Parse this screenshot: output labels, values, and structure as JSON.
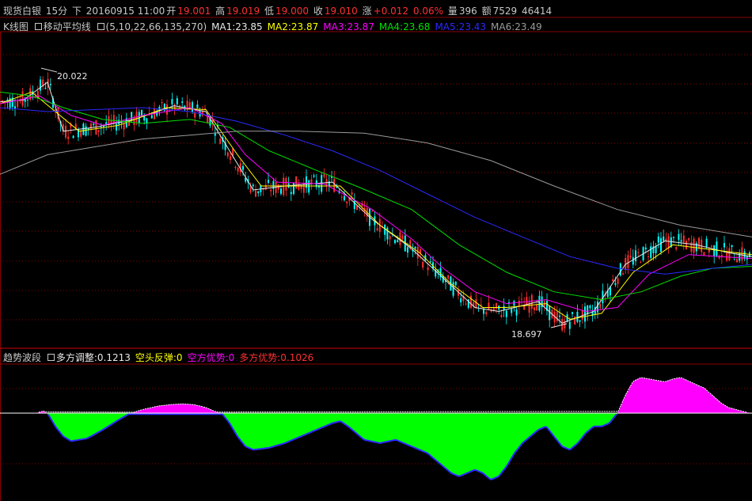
{
  "header": {
    "symbol": "现货白银",
    "period": "15分",
    "dir": "下",
    "datetime": "20160915 11:00",
    "open_label": "开",
    "open": "19.001",
    "high_label": "高",
    "high": "19.019",
    "low_label": "低",
    "low": "19.000",
    "close_label": "收",
    "close": "19.010",
    "change_label": "涨",
    "change": "+0.012",
    "change_pct": "0.06%",
    "volume_label": "量",
    "volume": "396",
    "amount_label": "额",
    "amount": "7529",
    "extra": "46414"
  },
  "ma_bar": {
    "chart_name": "K线图",
    "indicator": "移动平均线",
    "params": "(5,10,22,66,135,270)",
    "items": [
      {
        "label": "MA1:23.85",
        "color": "#e8e8e8"
      },
      {
        "label": "MA2:23.87",
        "color": "#ffff00"
      },
      {
        "label": "MA3:23.87",
        "color": "#ff00ff"
      },
      {
        "label": "MA4:23.68",
        "color": "#00e000"
      },
      {
        "label": "MA5:23.43",
        "color": "#2a2aff"
      },
      {
        "label": "MA6:23.49",
        "color": "#9a9a9a"
      }
    ]
  },
  "indicator_bar": {
    "name": "趋势波段",
    "items": [
      {
        "label": "多方调整:0.1213",
        "color": "#e8e8e8"
      },
      {
        "label": "空头反弹:0",
        "color": "#ffff00"
      },
      {
        "label": "空方优势:0",
        "color": "#ff00ff"
      },
      {
        "label": "多方优势:0.1026",
        "color": "#ff3030"
      }
    ]
  },
  "colors": {
    "grid": "#8b0000",
    "up": "#ff3030",
    "down": "#00ffff",
    "bull": "#ff00ff",
    "bear": "#00ff00",
    "bear_edge": "#2a2aff"
  },
  "chart_data": [
    {
      "type": "line",
      "title": "现货白银 15分",
      "annotations": [
        {
          "label": "20.022",
          "x": 52,
          "y": 20.022
        },
        {
          "label": "18.697",
          "x": 696,
          "y": 18.697
        }
      ],
      "ylim": [
        18.6,
        20.2
      ],
      "xlim": [
        0,
        950
      ],
      "series": [
        {
          "name": "MA1",
          "color": "#e8e8e8",
          "x": [
            0,
            30,
            60,
            80,
            120,
            170,
            220,
            260,
            290,
            320,
            360,
            420,
            470,
            520,
            560,
            600,
            630,
            680,
            710,
            750,
            790,
            840,
            880,
            920,
            950
          ],
          "values": [
            19.85,
            19.86,
            19.95,
            19.7,
            19.72,
            19.76,
            19.83,
            19.8,
            19.6,
            19.4,
            19.42,
            19.44,
            19.25,
            19.1,
            18.95,
            18.8,
            18.78,
            18.83,
            18.72,
            18.78,
            19.02,
            19.14,
            19.12,
            19.08,
            19.06
          ]
        },
        {
          "name": "MA2",
          "color": "#ffff00",
          "x": [
            0,
            40,
            70,
            100,
            150,
            210,
            260,
            300,
            330,
            370,
            430,
            480,
            530,
            570,
            610,
            640,
            690,
            720,
            760,
            800,
            850,
            890,
            950
          ],
          "values": [
            19.84,
            19.9,
            19.8,
            19.7,
            19.73,
            19.82,
            19.81,
            19.58,
            19.42,
            19.42,
            19.42,
            19.22,
            19.08,
            18.92,
            18.8,
            18.8,
            18.82,
            18.74,
            18.77,
            18.98,
            19.12,
            19.1,
            19.07
          ]
        },
        {
          "name": "MA3",
          "color": "#ff00ff",
          "x": [
            0,
            50,
            90,
            130,
            180,
            240,
            280,
            310,
            350,
            410,
            470,
            520,
            560,
            600,
            640,
            690,
            740,
            780,
            820,
            870,
            910,
            950
          ],
          "values": [
            19.84,
            19.88,
            19.78,
            19.73,
            19.78,
            19.82,
            19.74,
            19.58,
            19.44,
            19.43,
            19.3,
            19.15,
            19.0,
            18.88,
            18.82,
            18.84,
            18.78,
            18.8,
            18.97,
            19.07,
            19.06,
            19.05
          ]
        },
        {
          "name": "MA4",
          "color": "#00e000",
          "x": [
            0,
            40,
            80,
            130,
            180,
            240,
            290,
            340,
            400,
            450,
            520,
            580,
            640,
            700,
            760,
            810,
            860,
            900,
            950
          ],
          "values": [
            19.9,
            19.88,
            19.82,
            19.76,
            19.74,
            19.76,
            19.72,
            19.6,
            19.5,
            19.42,
            19.3,
            19.12,
            18.98,
            18.88,
            18.84,
            18.88,
            18.96,
            19.0,
            19.01
          ]
        },
        {
          "name": "MA5",
          "color": "#2a2aff",
          "x": [
            0,
            60,
            120,
            180,
            240,
            300,
            360,
            420,
            480,
            540,
            600,
            660,
            720,
            780,
            840,
            900,
            950
          ],
          "values": [
            19.82,
            19.8,
            19.81,
            19.82,
            19.8,
            19.75,
            19.68,
            19.6,
            19.5,
            19.38,
            19.26,
            19.16,
            19.06,
            19.0,
            18.97,
            19.0,
            19.02
          ]
        },
        {
          "name": "MA6",
          "color": "#9a9a9a",
          "x": [
            0,
            60,
            120,
            180,
            240,
            300,
            380,
            460,
            540,
            620,
            700,
            780,
            860,
            950
          ],
          "values": [
            19.48,
            19.58,
            19.62,
            19.66,
            19.68,
            19.7,
            19.7,
            19.69,
            19.64,
            19.55,
            19.42,
            19.3,
            19.22,
            19.16
          ]
        }
      ]
    },
    {
      "type": "area",
      "title": "趋势波段",
      "ylim": [
        -0.12,
        0.06
      ],
      "x": [
        0,
        45,
        55,
        60,
        70,
        80,
        90,
        110,
        130,
        150,
        165,
        180,
        200,
        215,
        230,
        245,
        260,
        270,
        280,
        290,
        300,
        310,
        320,
        340,
        360,
        380,
        400,
        420,
        430,
        440,
        450,
        460,
        480,
        500,
        520,
        540,
        560,
        570,
        580,
        590,
        600,
        610,
        620,
        630,
        640,
        650,
        660,
        670,
        680,
        690,
        700,
        710,
        720,
        730,
        740,
        750,
        760,
        770,
        780,
        790,
        800,
        810,
        820,
        830,
        840,
        850,
        860,
        870,
        880,
        890,
        900,
        910,
        920,
        930,
        940,
        950
      ],
      "values": [
        0.0,
        0.0,
        0.003,
        0.0,
        -0.02,
        -0.035,
        -0.042,
        -0.038,
        -0.025,
        -0.01,
        0.0,
        0.005,
        0.01,
        0.012,
        0.013,
        0.012,
        0.008,
        0.003,
        0.0,
        -0.015,
        -0.035,
        -0.05,
        -0.055,
        -0.052,
        -0.045,
        -0.035,
        -0.025,
        -0.015,
        -0.012,
        -0.02,
        -0.03,
        -0.04,
        -0.045,
        -0.04,
        -0.05,
        -0.06,
        -0.08,
        -0.09,
        -0.095,
        -0.09,
        -0.085,
        -0.09,
        -0.1,
        -0.095,
        -0.08,
        -0.06,
        -0.045,
        -0.035,
        -0.025,
        -0.02,
        -0.035,
        -0.05,
        -0.055,
        -0.045,
        -0.03,
        -0.02,
        -0.02,
        -0.015,
        0.0,
        0.025,
        0.045,
        0.05,
        0.048,
        0.046,
        0.044,
        0.048,
        0.05,
        0.045,
        0.04,
        0.035,
        0.025,
        0.015,
        0.008,
        0.005,
        0.002,
        0.0
      ]
    }
  ]
}
